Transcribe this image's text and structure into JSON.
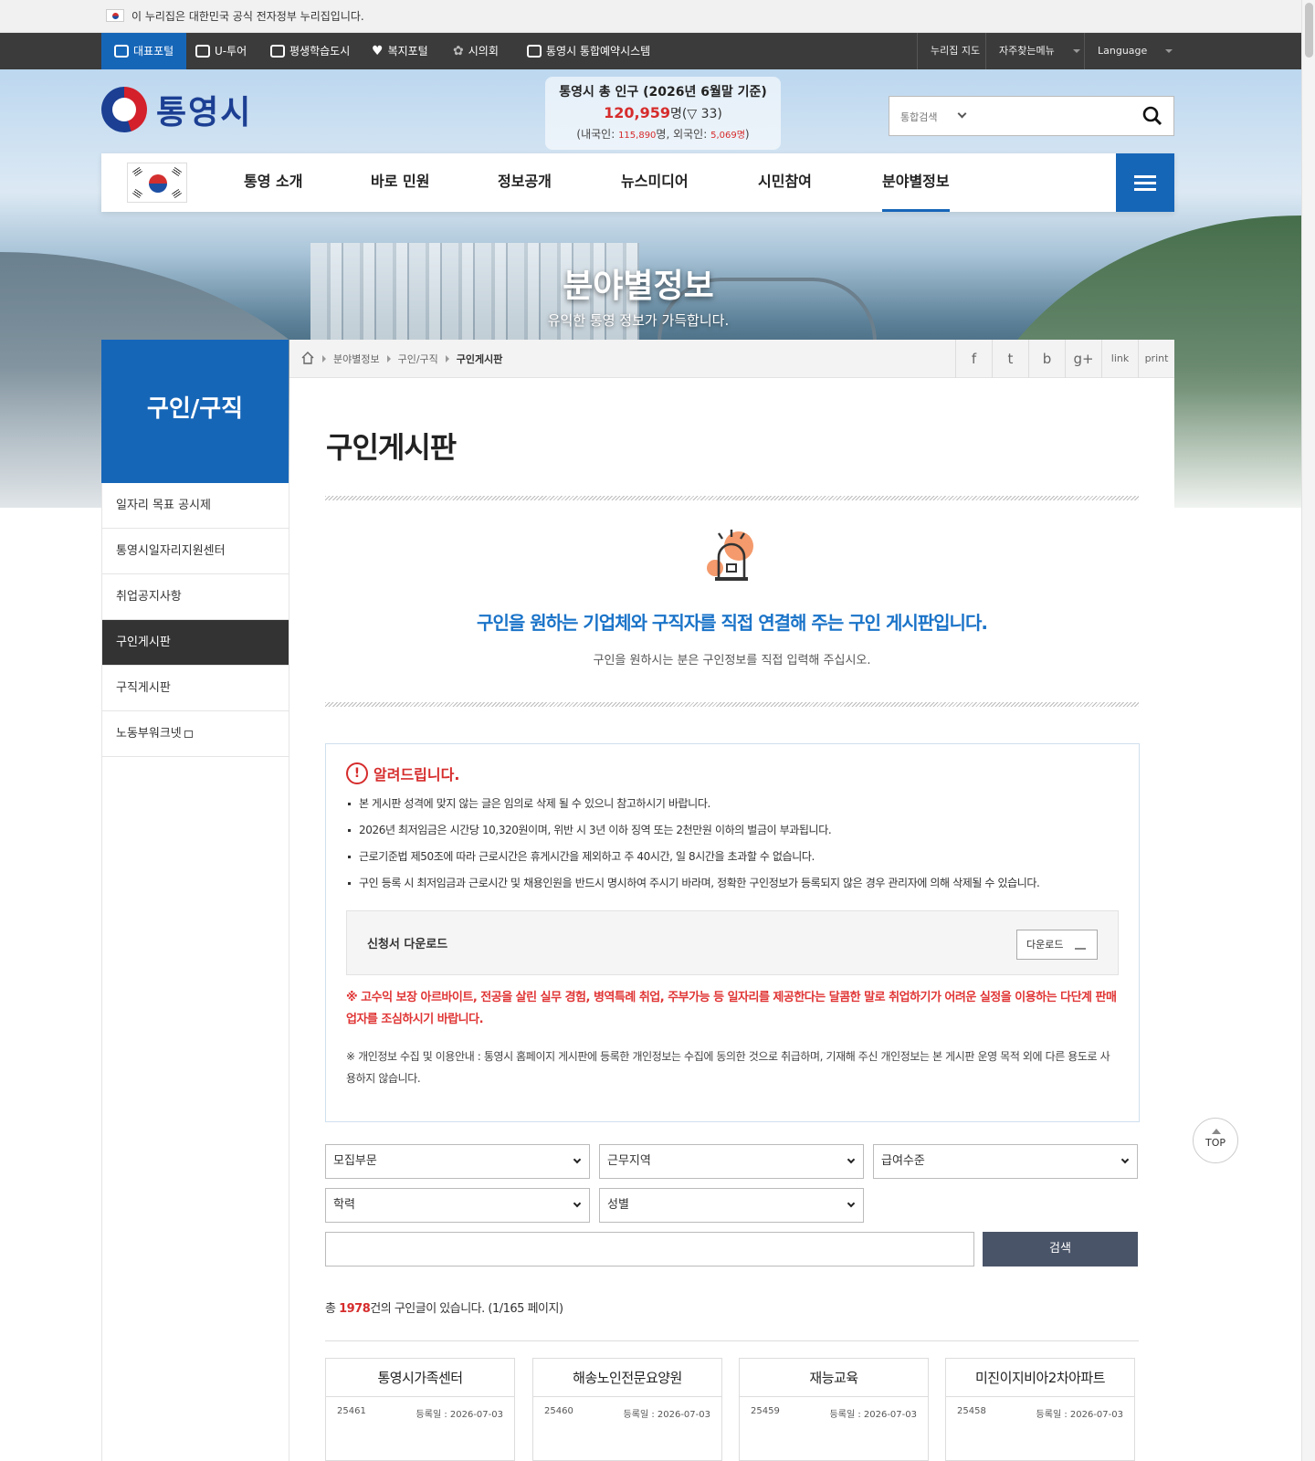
{
  "gov_banner": {
    "text": "이 누리집은 대한민국 공식 전자정부 누리집입니다."
  },
  "top_nav": {
    "items": [
      {
        "label": "대표포털",
        "icon": "portal-icon"
      },
      {
        "label": "U-투어",
        "icon": "tour-icon"
      },
      {
        "label": "평생학습도시",
        "icon": "book-icon"
      },
      {
        "label": "복지포털",
        "icon": "heart-icon"
      },
      {
        "label": "시의회",
        "icon": "council-icon"
      },
      {
        "label": "통영시 통합예약시스템",
        "icon": "calendar-icon"
      }
    ],
    "right": {
      "sitemap": "누리집 지도",
      "favorites": "자주찾는메뉴",
      "language": "Language"
    }
  },
  "logo": {
    "name": "통영시"
  },
  "population": {
    "title": "통영시 총 인구 (2026년 6월말 기준)",
    "total": "120,959",
    "unit": "명",
    "change": "(▽ 33)",
    "domestic_label": "(내국인: ",
    "domestic": "115,890",
    "foreign_label": "명, 외국인: ",
    "foreign": "5,069명",
    "close": ")"
  },
  "search": {
    "scope": "통합검색"
  },
  "gnb": {
    "items": [
      "통영 소개",
      "바로 민원",
      "정보공개",
      "뉴스미디어",
      "시민참여",
      "분야별정보"
    ],
    "active": "분야별정보"
  },
  "hero": {
    "title": "분야별정보",
    "subtitle": "유익한 통영 정보가 가득합니다."
  },
  "lnb": {
    "title": "구인/구직",
    "items": [
      "일자리 목표 공시제",
      "통영시일자리지원센터",
      "취업공지사항",
      "구인게시판",
      "구직게시판",
      "노동부워크넷"
    ],
    "active": "구인게시판"
  },
  "breadcrumb": {
    "items": [
      "분야별정보",
      "구인/구직",
      "구인게시판"
    ]
  },
  "share": [
    "f",
    "t",
    "b",
    "g+",
    "link",
    "print"
  ],
  "page_title": "구인게시판",
  "intro": {
    "heading": "구인을 원하는 기업체와 구직자를 직접 연결해 주는 구인 게시판입니다.",
    "sub": "구인을 원하시는 분은 구인정보를 직접 입력해 주십시오."
  },
  "notice": {
    "title": "알려드립니다.",
    "items": [
      "본 게시판 성격에 맞지 않는 글은 임의로 삭제 될 수 있으니 참고하시기 바랍니다.",
      "2026년 최저임금은 시간당 10,320원이며, 위반 시 3년 이하 징역 또는 2천만원 이하의 벌금이 부과됩니다.",
      "근로기준법 제50조에 따라 근로시간은 휴게시간을 제외하고 주 40시간, 일 8시간을 초과할 수 없습니다.",
      "구인 등록 시 최저임금과 근로시간 및 채용인원을 반드시 명시하여 주시기 바라며, 정확한 구인정보가 등록되지 않은 경우 관리자에 의해 삭제될 수 있습니다."
    ],
    "download_title": "신청서 다운로드",
    "download_button": "다운로드",
    "warning": "※ 고수익 보장 아르바이트, 전공을 살린 실무 경험, 병역특례 취업, 주부가능 등 일자리를 제공한다는 달콤한 말로 취업하기가 어려운 실정을 이용하는 다단계 판매업자를 조심하시기 바랍니다.",
    "privacy": "※ 개인정보 수집 및 이용안내 : 통영시 홈페이지 게시판에 등록한 개인정보는 수집에 동의한 것으로 취급하며, 기재해 주신 개인정보는 본 게시판 운영 목적 외에 다른 용도로 사용하지 않습니다."
  },
  "filters": {
    "dept": "모집부문",
    "area": "근무지역",
    "salary": "급여수준",
    "education": "학력",
    "gender": "성별",
    "search_button": "검색"
  },
  "summary": {
    "prefix": "총 ",
    "count": "1978",
    "suffix": "건의 구인글이 있습니다. (1/165 페이지)"
  },
  "cards": [
    {
      "title": "통영시가족센터",
      "no": "25461",
      "date": "등록일 : 2026-07-03"
    },
    {
      "title": "해송노인전문요양원",
      "no": "25460",
      "date": "등록일 : 2026-07-03"
    },
    {
      "title": "재능교육",
      "no": "25459",
      "date": "등록일 : 2026-07-03"
    },
    {
      "title": "미진이지비아2차아파트",
      "no": "25458",
      "date": "등록일 : 2026-07-03"
    }
  ],
  "top_button": "TOP",
  "colors": {
    "primary": "#1666b8",
    "accent_red": "#d62c2c",
    "topnav_bg": "#3b3b3b",
    "search_button": "#4a5468"
  }
}
